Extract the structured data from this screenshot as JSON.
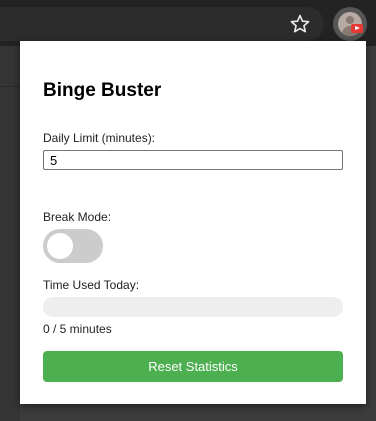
{
  "browser": {
    "toolbar_icons": [
      "star-icon",
      "extension-icon"
    ]
  },
  "popup": {
    "title": "Binge Buster",
    "daily_limit": {
      "label": "Daily Limit (minutes):",
      "value": "5"
    },
    "break_mode": {
      "label": "Break Mode:",
      "enabled": false
    },
    "time_used": {
      "label": "Time Used Today:",
      "progress_fraction": 0,
      "text": "0 / 5 minutes"
    },
    "reset_button": {
      "label": "Reset Statistics"
    }
  },
  "colors": {
    "accent_green": "#4caf50",
    "toggle_off": "#cccccc",
    "progress_track": "#eeeeee",
    "badge_red": "#e53935"
  }
}
